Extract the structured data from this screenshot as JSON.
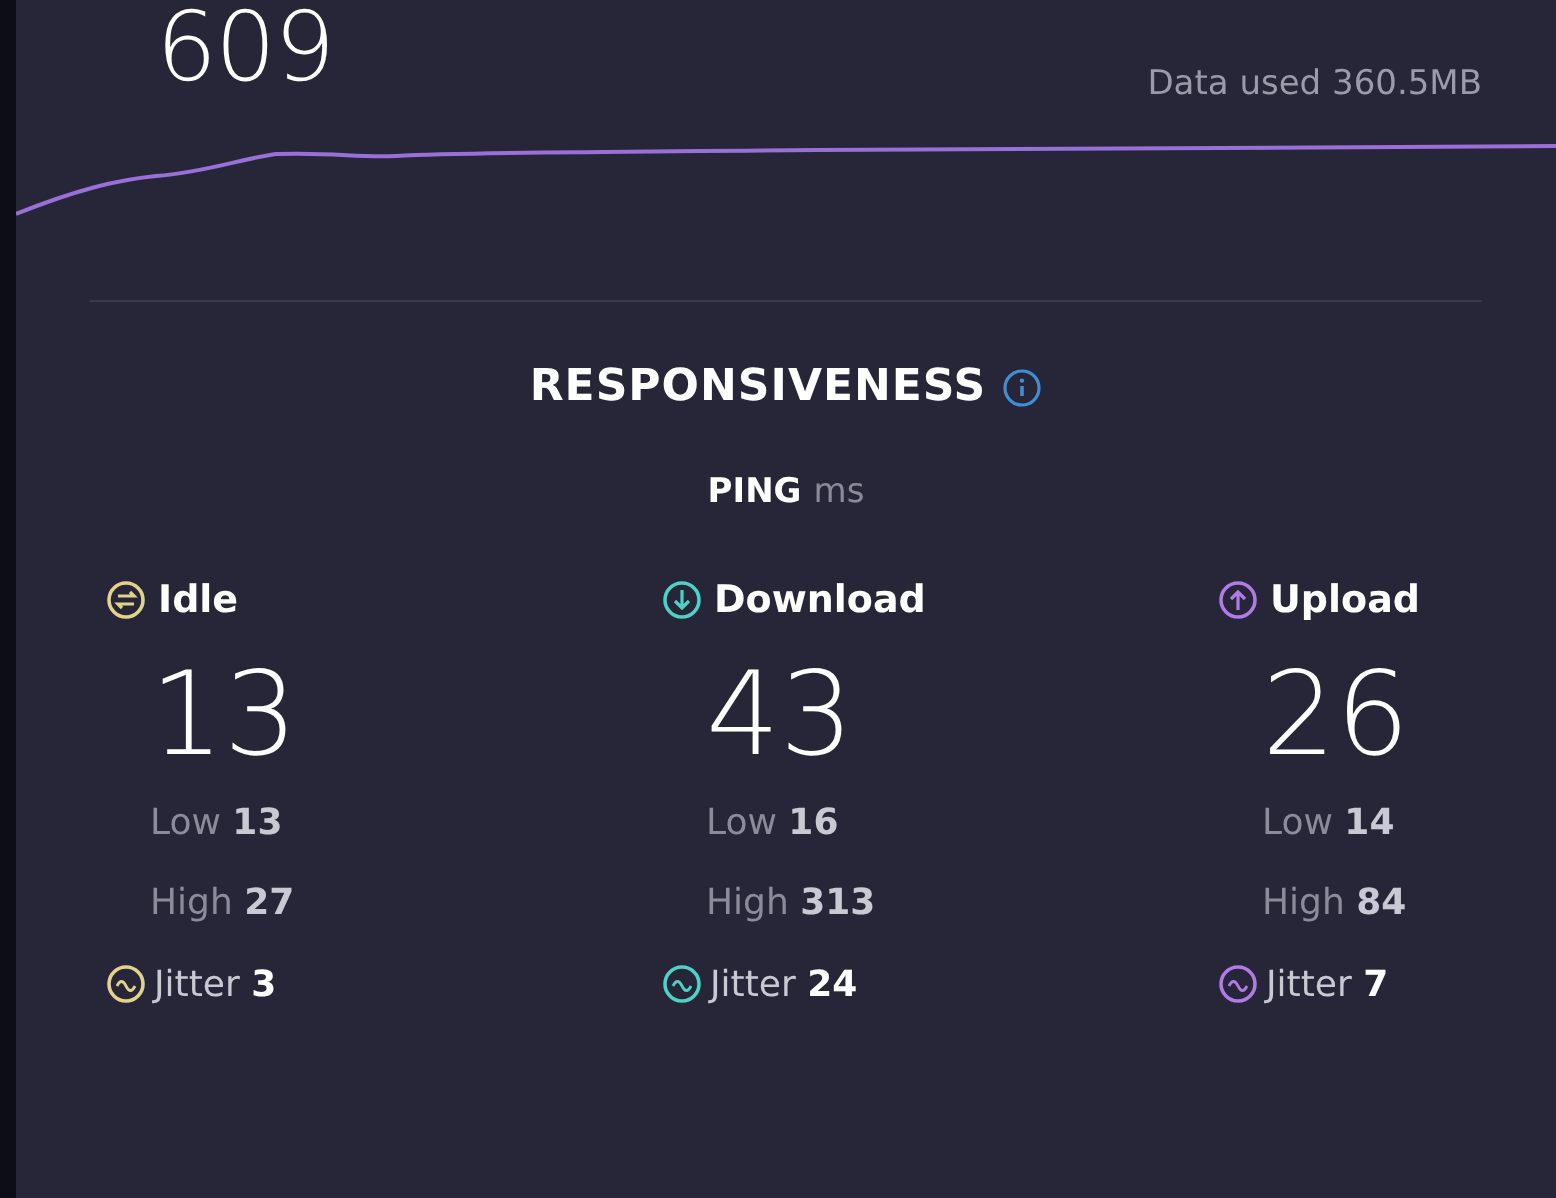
{
  "summary": {
    "value": "609",
    "data_used": "Data used 360.5MB"
  },
  "responsiveness": {
    "title": "RESPONSIVENESS",
    "metric": "PING",
    "unit": "ms",
    "columns": [
      {
        "kind": "idle",
        "label": "Idle",
        "color": "#e3d28a",
        "value": "13",
        "low": "Low **13**",
        "high": "High **27**",
        "jitter": "Jitter **3**"
      },
      {
        "kind": "download",
        "label": "Download",
        "color": "#4fd1c5",
        "value": "43",
        "low": "Low **16**",
        "high": "High **313**",
        "jitter": "Jitter **24**"
      },
      {
        "kind": "upload",
        "label": "Upload",
        "color": "#b07be8",
        "value": "26",
        "low": "Low **14**",
        "high": "High **84**",
        "jitter": "Jitter **7**"
      }
    ]
  }
}
